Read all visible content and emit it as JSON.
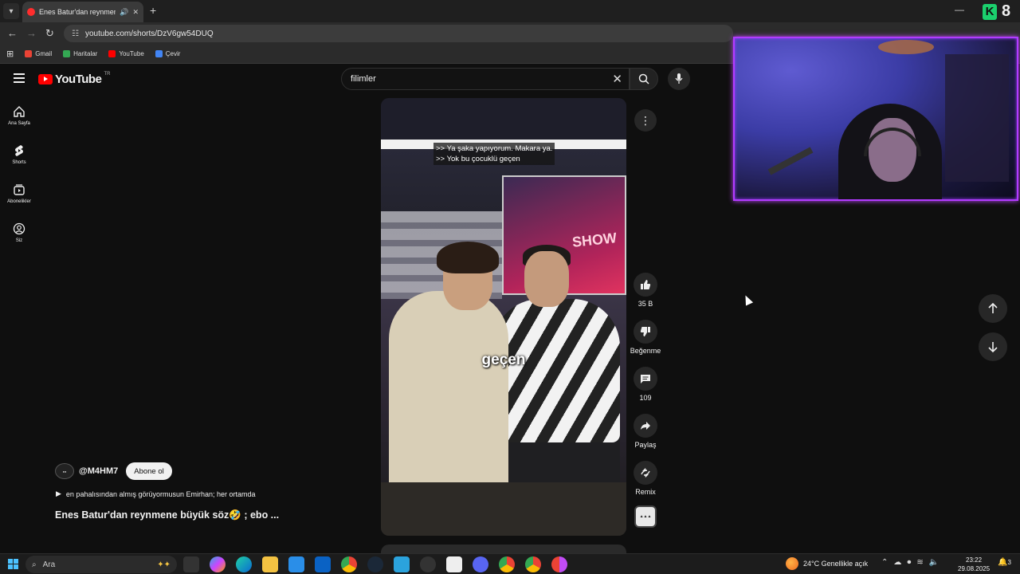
{
  "browser": {
    "tab_title": "Enes Batur'dan reynmene büyük söz",
    "url": "youtube.com/shorts/DzV6gw54DUQ",
    "bookmarks": [
      {
        "label": "Gmail",
        "color": "#ea4335"
      },
      {
        "label": "Haritalar",
        "color": "#34a853"
      },
      {
        "label": "YouTube",
        "color": "#ff0000"
      },
      {
        "label": "Çevir",
        "color": "#4285f4"
      }
    ],
    "badge_number": "8"
  },
  "youtube": {
    "logo": "YouTube",
    "region": "TR",
    "search_value": "filimler",
    "nav": [
      {
        "label": "Ana Sayfa",
        "icon": "home-icon"
      },
      {
        "label": "Shorts",
        "icon": "shorts-icon"
      },
      {
        "label": "Abonelikler",
        "icon": "subscriptions-icon"
      },
      {
        "label": "Siz",
        "icon": "you-icon"
      }
    ]
  },
  "short": {
    "subtitles": [
      ">> Ya şaka yapıyorum. Makara ya.",
      ">> Yok bu çocuklü geçen"
    ],
    "caption": "geçen",
    "show_logo": "SHOW",
    "actions": {
      "like_count": "35 B",
      "dislike_label": "Beğenme",
      "comment_count": "109",
      "share_label": "Paylaş",
      "remix_label": "Remix"
    },
    "channel": "@M4HM7",
    "subscribe_label": "Abone ol",
    "description": "en pahalısından almış görüyormusun Emirhan; her ortamda",
    "title": "Enes Batur'dan reynmene büyük söz🤣 ; ebo ..."
  },
  "taskbar": {
    "search_placeholder": "Ara",
    "weather": "24°C  Genellikle açık",
    "time": "23:22",
    "date": "29.08.2025",
    "notifications": "3"
  }
}
